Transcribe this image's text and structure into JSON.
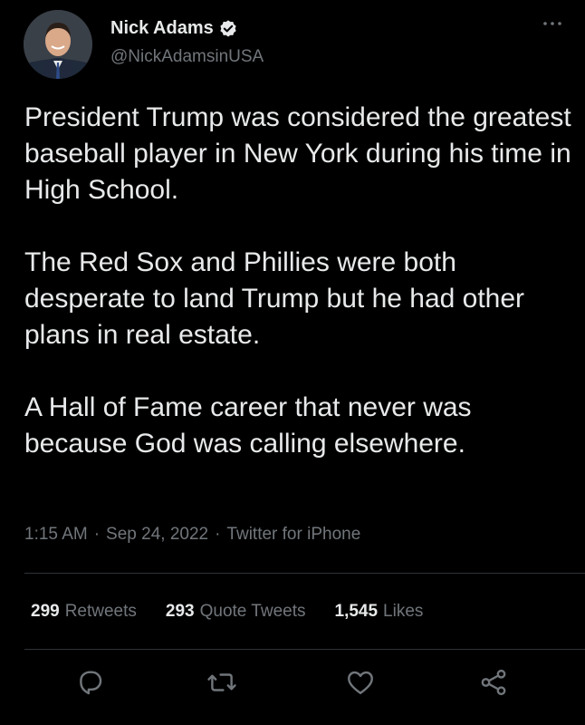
{
  "author": {
    "name": "Nick Adams",
    "handle": "@NickAdamsinUSA",
    "verified_icon": "verified-badge-icon"
  },
  "tweet": {
    "paragraphs": [
      "President Trump was considered the greatest baseball player in New York during his time in High School.",
      "The Red Sox and Phillies were both desperate to land Trump but he had other plans in real estate.",
      "A Hall of Fame career that never was because God was calling elsewhere."
    ]
  },
  "meta": {
    "time": "1:15 AM",
    "date": "Sep 24, 2022",
    "source": "Twitter for iPhone",
    "separator": "·"
  },
  "stats": {
    "retweets_count": "299",
    "retweets_label": "Retweets",
    "quotes_count": "293",
    "quotes_label": "Quote Tweets",
    "likes_count": "1,545",
    "likes_label": "Likes"
  },
  "actions": [
    "reply-icon",
    "retweet-icon",
    "like-icon",
    "share-icon"
  ],
  "colors": {
    "background": "#000000",
    "primary_text": "#e7e9ea",
    "secondary_text": "#71767b",
    "divider": "#2f3336",
    "verified_badge": "#e7e9ea"
  }
}
